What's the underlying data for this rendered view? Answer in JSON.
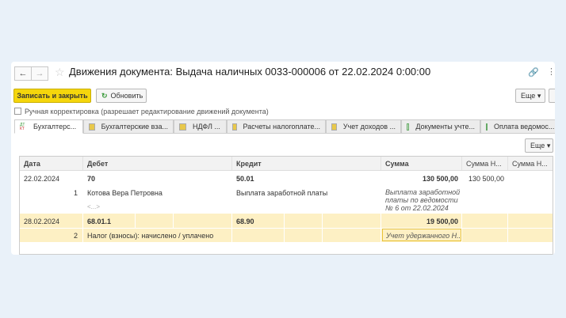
{
  "window": {
    "title": "Движения документа: Выдача наличных 0033-000006 от 22.02.2024 0:00:00"
  },
  "toolbar": {
    "save_close": "Записать и закрыть",
    "refresh": "Обновить",
    "more": "Еще",
    "more2": "Еще"
  },
  "manual": {
    "label": "Ручная корректировка (разрешает редактирование движений документа)",
    "checked": false
  },
  "tabs": [
    {
      "label": "Бухгалтерс...",
      "icon": "dt-kt-icon"
    },
    {
      "label": "Бухгалтерские вза...",
      "icon": "register-icon"
    },
    {
      "label": "НДФЛ ...",
      "icon": "register-icon"
    },
    {
      "label": "Расчеты налогоплате...",
      "icon": "register-icon"
    },
    {
      "label": "Учет доходов ...",
      "icon": "register-icon"
    },
    {
      "label": "Документы учте...",
      "icon": "table-icon"
    },
    {
      "label": "Оплата ведомос...",
      "icon": "table-icon"
    }
  ],
  "table": {
    "headers": {
      "date": "Дата",
      "debit": "Дебет",
      "credit": "Кредит",
      "sum": "Сумма",
      "sum_n1": "Сумма Н...",
      "sum_n2": "Сумма Н..."
    },
    "rows": [
      {
        "date": "22.02.2024",
        "num": "1",
        "debit": "70",
        "debit_sub1": "Котова Вера Петровна",
        "debit_sub2": "<...>",
        "credit": "50.01",
        "credit_sub1": "Выплата заработной платы",
        "sum": "130 500,00",
        "sum_n1": "130 500,00",
        "content": [
          "Выплата заработной",
          "платы по ведомости",
          "№ 6 от 22.02.2024"
        ]
      },
      {
        "date": "28.02.2024",
        "num": "2",
        "debit": "68.01.1",
        "debit_sub1": "Налог (взносы): начислено / уплачено",
        "credit": "68.90",
        "sum": "19 500,00",
        "content": "Учет удержанного Н..."
      }
    ]
  }
}
